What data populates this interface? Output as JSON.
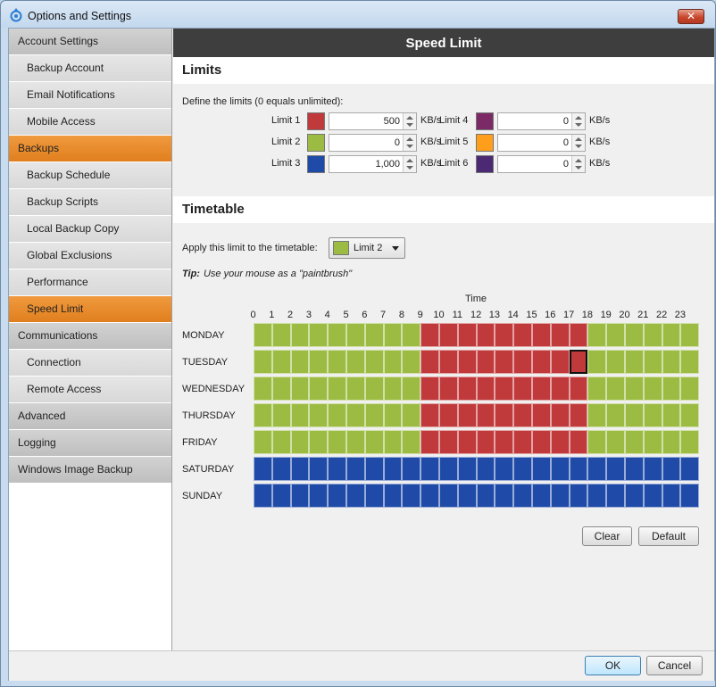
{
  "window": {
    "title": "Options and Settings",
    "close_label": "✕"
  },
  "sidebar": {
    "items": [
      {
        "label": "Account Settings",
        "level": 0,
        "active": false
      },
      {
        "label": "Backup Account",
        "level": 1,
        "active": false
      },
      {
        "label": "Email Notifications",
        "level": 1,
        "active": false
      },
      {
        "label": "Mobile Access",
        "level": 1,
        "active": false
      },
      {
        "label": "Backups",
        "level": 0,
        "active": true
      },
      {
        "label": "Backup Schedule",
        "level": 1,
        "active": false
      },
      {
        "label": "Backup Scripts",
        "level": 1,
        "active": false
      },
      {
        "label": "Local Backup Copy",
        "level": 1,
        "active": false
      },
      {
        "label": "Global Exclusions",
        "level": 1,
        "active": false
      },
      {
        "label": "Performance",
        "level": 1,
        "active": false
      },
      {
        "label": "Speed Limit",
        "level": 1,
        "active": true
      },
      {
        "label": "Communications",
        "level": 0,
        "active": false
      },
      {
        "label": "Connection",
        "level": 1,
        "active": false
      },
      {
        "label": "Remote Access",
        "level": 1,
        "active": false
      },
      {
        "label": "Advanced",
        "level": 0,
        "active": false
      },
      {
        "label": "Logging",
        "level": 0,
        "active": false
      },
      {
        "label": "Windows Image Backup",
        "level": 0,
        "active": false
      }
    ]
  },
  "main": {
    "header": "Speed Limit",
    "limits": {
      "title": "Limits",
      "description": "Define the limits (0 equals unlimited):",
      "unit": "KB/s",
      "items": [
        {
          "label": "Limit 1",
          "color": "#c0393b",
          "value": "500"
        },
        {
          "label": "Limit 2",
          "color": "#9bbb43",
          "value": "0"
        },
        {
          "label": "Limit 3",
          "color": "#1f4aa8",
          "value": "1,000"
        },
        {
          "label": "Limit 4",
          "color": "#7b2a66",
          "value": "0"
        },
        {
          "label": "Limit 5",
          "color": "#ff9e1b",
          "value": "0"
        },
        {
          "label": "Limit 6",
          "color": "#4b2a73",
          "value": "0"
        }
      ]
    },
    "timetable": {
      "title": "Timetable",
      "apply_label": "Apply this limit to the timetable:",
      "selected_limit": "Limit 2",
      "selected_color": "#9bbb43",
      "tip_label": "Tip:",
      "tip_text": "Use your mouse as a \"paintbrush\"",
      "time_label": "Time",
      "hours": [
        "0",
        "1",
        "2",
        "3",
        "4",
        "5",
        "6",
        "7",
        "8",
        "9",
        "10",
        "11",
        "12",
        "13",
        "14",
        "15",
        "16",
        "17",
        "18",
        "19",
        "20",
        "21",
        "22",
        "23"
      ],
      "days": [
        "MONDAY",
        "TUESDAY",
        "WEDNESDAY",
        "THURSDAY",
        "FRIDAY",
        "SATURDAY",
        "SUNDAY"
      ],
      "colors": {
        "1": "#c0393b",
        "2": "#9bbb43",
        "3": "#1f4aa8"
      },
      "grid": [
        [
          2,
          2,
          2,
          2,
          2,
          2,
          2,
          2,
          2,
          1,
          1,
          1,
          1,
          1,
          1,
          1,
          1,
          1,
          2,
          2,
          2,
          2,
          2,
          2
        ],
        [
          2,
          2,
          2,
          2,
          2,
          2,
          2,
          2,
          2,
          1,
          1,
          1,
          1,
          1,
          1,
          1,
          1,
          1,
          2,
          2,
          2,
          2,
          2,
          2
        ],
        [
          2,
          2,
          2,
          2,
          2,
          2,
          2,
          2,
          2,
          1,
          1,
          1,
          1,
          1,
          1,
          1,
          1,
          1,
          2,
          2,
          2,
          2,
          2,
          2
        ],
        [
          2,
          2,
          2,
          2,
          2,
          2,
          2,
          2,
          2,
          1,
          1,
          1,
          1,
          1,
          1,
          1,
          1,
          1,
          2,
          2,
          2,
          2,
          2,
          2
        ],
        [
          2,
          2,
          2,
          2,
          2,
          2,
          2,
          2,
          2,
          1,
          1,
          1,
          1,
          1,
          1,
          1,
          1,
          1,
          2,
          2,
          2,
          2,
          2,
          2
        ],
        [
          3,
          3,
          3,
          3,
          3,
          3,
          3,
          3,
          3,
          3,
          3,
          3,
          3,
          3,
          3,
          3,
          3,
          3,
          3,
          3,
          3,
          3,
          3,
          3
        ],
        [
          3,
          3,
          3,
          3,
          3,
          3,
          3,
          3,
          3,
          3,
          3,
          3,
          3,
          3,
          3,
          3,
          3,
          3,
          3,
          3,
          3,
          3,
          3,
          3
        ]
      ],
      "highlight": {
        "day": 1,
        "hour": 17
      },
      "clear_label": "Clear",
      "default_label": "Default"
    }
  },
  "footer": {
    "ok_label": "OK",
    "cancel_label": "Cancel"
  }
}
